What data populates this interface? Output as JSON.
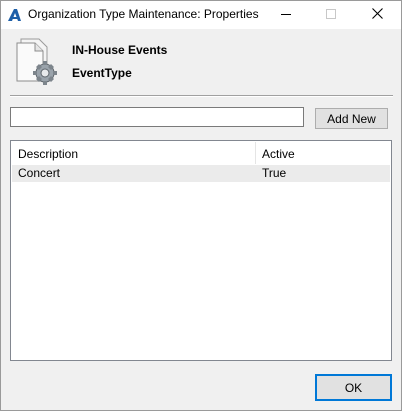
{
  "window": {
    "title": "Organization Type Maintenance: Properties",
    "controls": {
      "minimize": "minimize-icon",
      "maximize": "maximize-icon",
      "close": "close-icon"
    }
  },
  "header": {
    "title": "IN-House Events",
    "subtitle": "EventType",
    "icon": "document-settings-icon"
  },
  "filter": {
    "value": "",
    "placeholder": ""
  },
  "buttons": {
    "add_new": "Add New",
    "ok": "OK"
  },
  "table": {
    "columns": [
      "Description",
      "Active"
    ],
    "rows": [
      {
        "description": "Concert",
        "active": "True"
      }
    ]
  },
  "colors": {
    "accent": "#0078d7",
    "window_bg": "#f0f0f0",
    "selected_row": "#ebebeb"
  }
}
